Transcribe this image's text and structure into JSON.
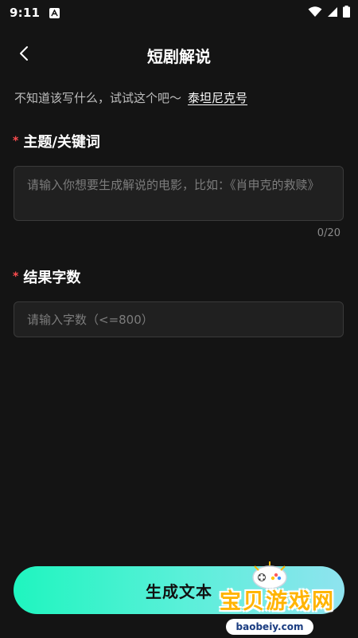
{
  "status_bar": {
    "time": "9:11",
    "icons": [
      "a-notification-icon",
      "wifi-icon",
      "signal-icon",
      "battery-icon"
    ]
  },
  "header": {
    "title": "短剧解说",
    "back_icon": "back-chevron-icon"
  },
  "suggestion": {
    "prompt": "不知道该写什么，试试这个吧～",
    "link": "泰坦尼克号"
  },
  "topic": {
    "label": "主题/关键词",
    "required_mark": "*",
    "placeholder": "请输入你想要生成解说的电影，比如：《肖申克的救赎》",
    "value": "",
    "counter": "0/20"
  },
  "word_count": {
    "label": "结果字数",
    "required_mark": "*",
    "placeholder": "请输入字数（<=800）",
    "value": ""
  },
  "generate_button": {
    "label": "生成文本"
  },
  "watermark": {
    "text": "宝贝游戏网",
    "url": "baobeiy.com"
  },
  "colors": {
    "background": "#141414",
    "required": "#ff4d4f",
    "button_gradient_start": "#1ff5bf",
    "button_gradient_end": "#8fe3ef",
    "watermark": "#ffb400"
  }
}
